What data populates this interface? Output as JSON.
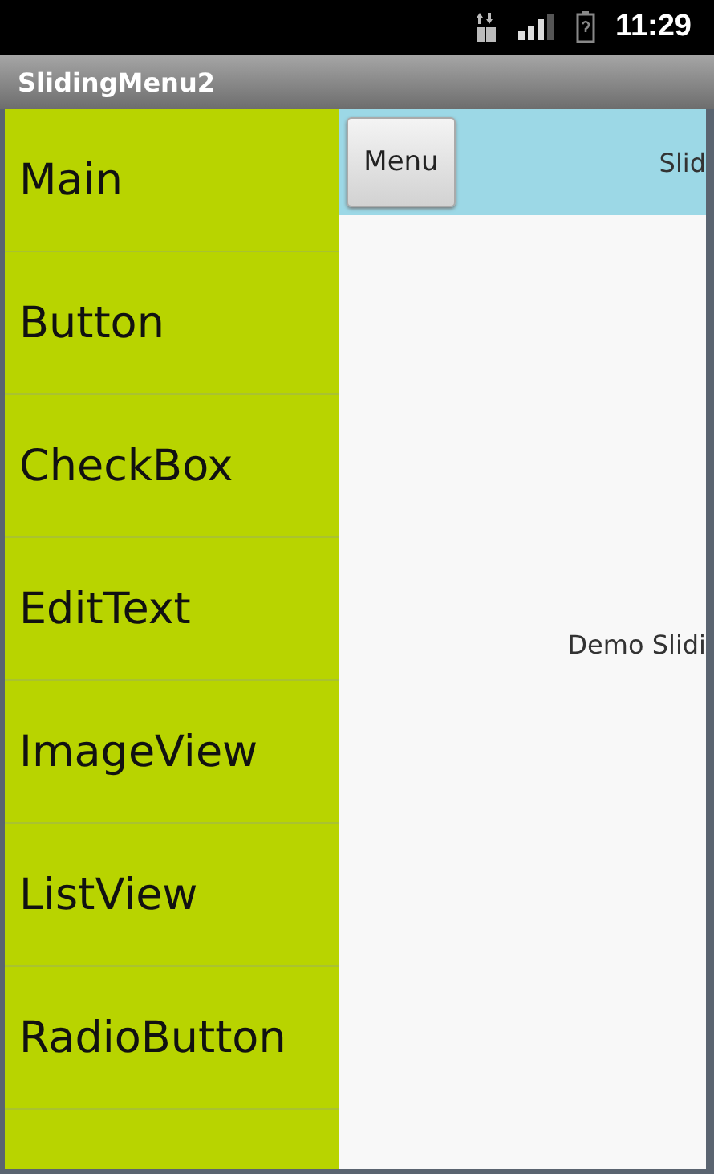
{
  "status_bar": {
    "time": "11:29"
  },
  "window": {
    "title": "SlidingMenu2"
  },
  "menu": {
    "items": [
      {
        "label": "Main"
      },
      {
        "label": "Button"
      },
      {
        "label": "CheckBox"
      },
      {
        "label": "EditText"
      },
      {
        "label": "ImageView"
      },
      {
        "label": "ListView"
      },
      {
        "label": "RadioButton"
      }
    ]
  },
  "content": {
    "menu_button": "Menu",
    "header_title": "Slid",
    "body_text": "Demo Slidi"
  }
}
